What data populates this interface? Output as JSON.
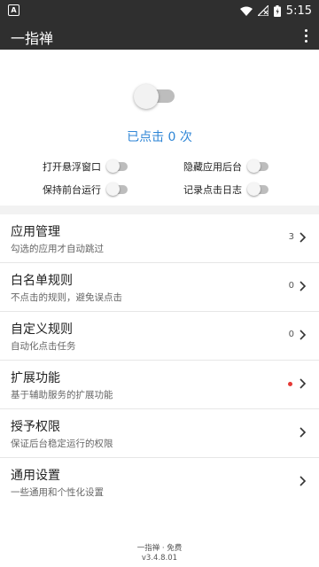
{
  "status_bar": {
    "time": "5:15",
    "notification_icon": "a-notification-icon"
  },
  "toolbar": {
    "title": "一指禅",
    "menu_icon": "more-vert-icon"
  },
  "main_switch": {
    "on": false
  },
  "click_count_text": "已点击 0 次",
  "options": [
    {
      "label": "打开悬浮窗口",
      "on": false
    },
    {
      "label": "隐藏应用后台",
      "on": false
    },
    {
      "label": "保持前台运行",
      "on": false
    },
    {
      "label": "记录点击日志",
      "on": false
    }
  ],
  "menu": [
    {
      "title": "应用管理",
      "subtitle": "勾选的应用才自动跳过",
      "count": "3"
    },
    {
      "title": "白名单规则",
      "subtitle": "不点击的规则，避免误点击",
      "count": "0"
    },
    {
      "title": "自定义规则",
      "subtitle": "自动化点击任务",
      "count": "0"
    },
    {
      "title": "扩展功能",
      "subtitle": "基于辅助服务的扩展功能",
      "badge_color": "#e53935"
    },
    {
      "title": "授予权限",
      "subtitle": "保证后台稳定运行的权限"
    },
    {
      "title": "通用设置",
      "subtitle": "一些通用和个性化设置"
    }
  ],
  "footer": {
    "line1": "一指禅 · 免费",
    "line2": "v3.4.8.01"
  }
}
